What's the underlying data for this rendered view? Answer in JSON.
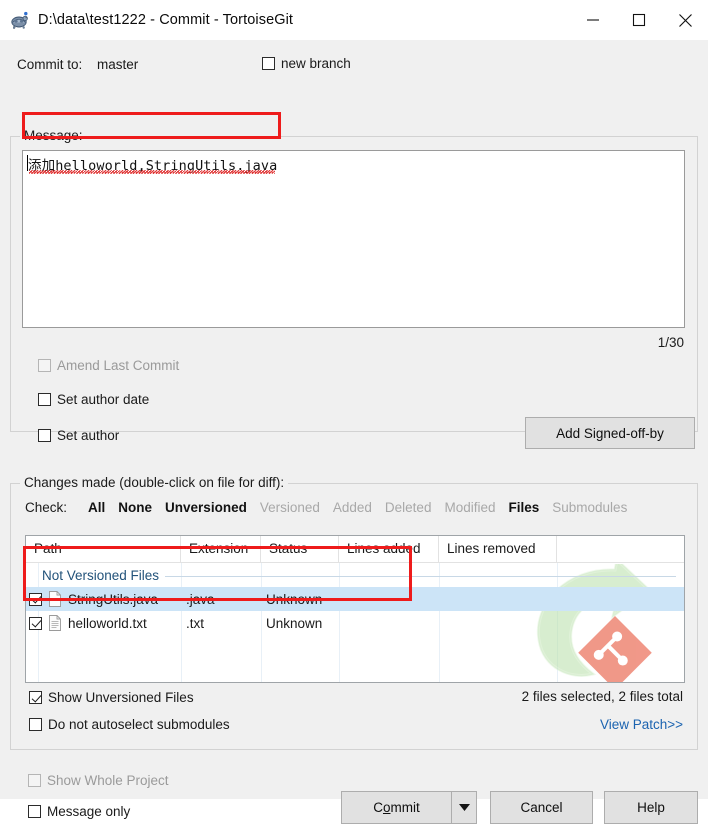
{
  "window": {
    "title": "D:\\data\\test1222 - Commit - TortoiseGit",
    "app_icon": "tortoise-icon",
    "minimize": "minimize-icon",
    "maximize": "maximize-icon",
    "close": "close-icon"
  },
  "commit_to": {
    "label": "Commit to:",
    "branch": "master",
    "new_branch_label": "new branch",
    "new_branch_checked": false
  },
  "message": {
    "group_title": "Message:",
    "text": "添加helloworld,StringUtils.java",
    "placeholder": "",
    "counter": "1/30",
    "amend_label": "Amend Last Commit",
    "amend_checked": false,
    "amend_disabled": true,
    "set_author_date_label": "Set author date",
    "set_author_date_checked": false,
    "set_author_label": "Set author",
    "set_author_checked": false,
    "signoff_button": "Add Signed-off-by"
  },
  "changes": {
    "group_title": "Changes made (double-click on file for diff):",
    "check_label": "Check:",
    "check_items": [
      {
        "label": "All",
        "enabled": true
      },
      {
        "label": "None",
        "enabled": true
      },
      {
        "label": "Unversioned",
        "enabled": true
      },
      {
        "label": "Versioned",
        "enabled": false
      },
      {
        "label": "Added",
        "enabled": false
      },
      {
        "label": "Deleted",
        "enabled": false
      },
      {
        "label": "Modified",
        "enabled": false
      },
      {
        "label": "Files",
        "enabled": true
      },
      {
        "label": "Submodules",
        "enabled": false
      }
    ],
    "columns": [
      "Path",
      "Extension",
      "Status",
      "Lines added",
      "Lines removed"
    ],
    "group_header": "Not Versioned Files",
    "rows": [
      {
        "checked": true,
        "icon": "java-file-icon",
        "path": "StringUtils.java",
        "extension": ".java",
        "status": "Unknown",
        "lines_added": "",
        "lines_removed": "",
        "selected": true
      },
      {
        "checked": true,
        "icon": "text-file-icon",
        "path": "helloworld.txt",
        "extension": ".txt",
        "status": "Unknown",
        "lines_added": "",
        "lines_removed": "",
        "selected": false
      }
    ],
    "show_unversioned_label": "Show Unversioned Files",
    "show_unversioned_checked": true,
    "no_autoselect_label": "Do not autoselect submodules",
    "no_autoselect_checked": false,
    "files_summary": "2 files selected, 2 files total",
    "view_patch": "View Patch>>"
  },
  "footer": {
    "show_whole_project_label": "Show Whole Project",
    "show_whole_project_checked": false,
    "show_whole_project_disabled": true,
    "message_only_label": "Message only",
    "message_only_checked": false,
    "commit_button_pre": "C",
    "commit_button_acc": "o",
    "commit_button_post": "mmit",
    "commit_dropdown": "chevron-down-icon",
    "cancel_button": "Cancel",
    "help_button": "Help"
  },
  "colors": {
    "annotation_red": "#ee1b1b",
    "selection_blue": "#cce4f7",
    "link_blue": "#1b63b0",
    "group_header_blue": "#22527a",
    "disabled_gray": "#a8a8a8",
    "window_bg": "#f0f0f0"
  }
}
